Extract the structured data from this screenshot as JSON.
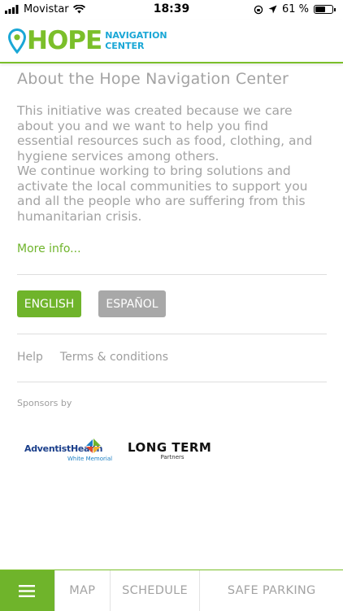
{
  "status": {
    "carrier": "Movistar",
    "time": "18:39",
    "battery": "61 %",
    "battery_level": 0.61
  },
  "header": {
    "logo_main": "HOPE",
    "logo_line1": "NAVIGATION",
    "logo_line2": "CENTER",
    "brand_green": "#7bbf2a",
    "brand_blue": "#1aa7d6"
  },
  "about": {
    "title": "About the Hope Navigation Center",
    "lines": [
      "This initiative was created because we care",
      "about you and we want to help you find",
      "essential resources such as food, clothing, and",
      "hygiene services among others.",
      "We continue working to bring solutions and",
      "activate the local communities to support you",
      "and all the people who are suffering from this",
      "humanitarian crisis."
    ],
    "more_info": "More info..."
  },
  "language": {
    "english": "ENGLISH",
    "spanish": "ESPAÑOL"
  },
  "links": {
    "help": "Help",
    "terms": "Terms & conditions"
  },
  "sponsors": {
    "label": "Sponsors by",
    "adventist_main": "AdventistHealth",
    "adventist_sub": "White Memorial",
    "longterm_main": "LONG TERM",
    "longterm_sub": "Partners"
  },
  "tabbar": {
    "menu_icon": "hamburger-menu-icon",
    "map": "MAP",
    "schedule": "SCHEDULE",
    "safe_parking": "SAFE PARKING"
  }
}
